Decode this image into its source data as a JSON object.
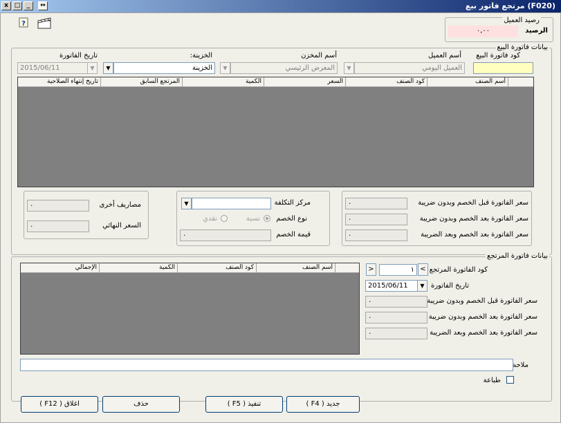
{
  "window": {
    "title": "(F020) مرتجع فاتور بيع",
    "buttons": {
      "close": "x",
      "restore": "□",
      "minimize": "_",
      "resize": "↔"
    }
  },
  "icons": {
    "help": "help-icon",
    "film": "clapperboard-icon"
  },
  "client_balance": {
    "legend": "رصيد العميل",
    "label": "الرصيد",
    "value": "٠,٠٠"
  },
  "sales_invoice": {
    "legend": "بيانات فاتورة البيع",
    "code_label": "كود فاتورة البيع",
    "code_value": "",
    "customer_label": "أسم العميل",
    "customer_value": "العميل اليومي",
    "store_label": "أسم المخزن",
    "store_value": "المعرض الرئيسي",
    "treasury_label": "الخزينة:",
    "treasury_value": "الخزينة",
    "date_label": "تاريخ الفاتورة",
    "date_value": "2015/06/11",
    "columns": [
      "أسم الصنف",
      "كود الصنف",
      "السعر",
      "الكمية",
      "المرتجع السابق",
      "تاريخ إنتهاء الصلاحية"
    ]
  },
  "totals": {
    "before_discount_label": "سعر الفاتورة قبل الخصم وبدون ضريبة",
    "after_discount_no_tax_label": "سعر الفاتورة بعد الخصم وبدون ضريبة",
    "after_discount_tax_label": "سعر الفاتورة بعد الخصم وبعد الضريبة",
    "before_discount_value": "٠",
    "after_discount_no_tax_value": "٠",
    "after_discount_tax_value": "٠"
  },
  "cost": {
    "center_label": "مركز التكلفة",
    "center_value": "",
    "discount_type_label": "نوع الخصم",
    "option_percent": "نسبة",
    "option_cash": "نقدي",
    "discount_value_label": "قيمة الخصم",
    "discount_value": "٠"
  },
  "other": {
    "expenses_label": "مصاريف أخرى",
    "expenses_value": "٠",
    "final_label": "السعر النهائي",
    "final_value": "٠"
  },
  "return_invoice": {
    "legend": "بيانات فاتورة المرتجع",
    "code_label": "كود الفاتورة المرتجع",
    "code_value": "١",
    "prev": "<",
    "next": ">",
    "date_label": "تاريخ الفاتورة",
    "date_value": "2015/06/11",
    "before_discount_label": "سعر الفاتورة قبل الخصم وبدون ضريبة",
    "after_discount_no_tax_label": "سعر الفاتورة بعد الخصم وبدون ضريبة",
    "after_discount_tax_label": "سعر الفاتورة بعد الخصم وبعد الضريبة",
    "before_discount_value": "٠",
    "after_discount_no_tax_value": "٠",
    "after_discount_tax_value": "٠",
    "columns": [
      "أسم الصنف",
      "كود الصنف",
      "الكمية",
      "الإجمالي"
    ],
    "notes_label": "ملاحظات",
    "notes_value": "",
    "print_label": "طباعة"
  },
  "actions": {
    "new": "جديد ( F4 )",
    "execute": "تنفيذ ( F5 )",
    "delete": "حذف",
    "close": "اغلاق ( F12 )"
  }
}
